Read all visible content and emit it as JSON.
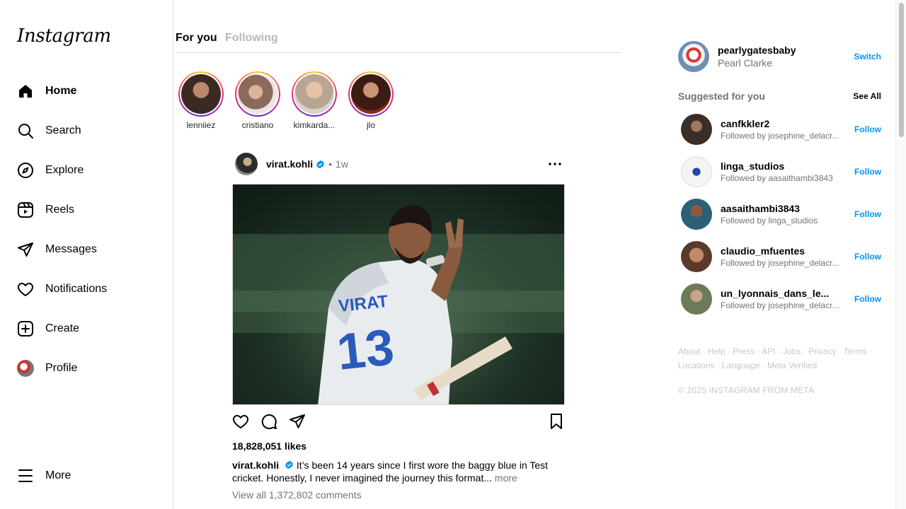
{
  "app": {
    "logo": "Instagram"
  },
  "sidebar": {
    "items": [
      {
        "label": "Home",
        "icon": "home-icon"
      },
      {
        "label": "Search",
        "icon": "search-icon"
      },
      {
        "label": "Explore",
        "icon": "compass-icon"
      },
      {
        "label": "Reels",
        "icon": "reels-icon"
      },
      {
        "label": "Messages",
        "icon": "send-icon"
      },
      {
        "label": "Notifications",
        "icon": "heart-icon"
      },
      {
        "label": "Create",
        "icon": "plus-square-icon"
      },
      {
        "label": "Profile",
        "icon": "avatar"
      }
    ],
    "more_label": "More"
  },
  "feed": {
    "tabs": [
      {
        "label": "For you"
      },
      {
        "label": "Following"
      }
    ],
    "stories": [
      {
        "name": "lenniiez"
      },
      {
        "name": "cristiano"
      },
      {
        "name": "kimkarda..."
      },
      {
        "name": "jlo"
      }
    ]
  },
  "post": {
    "username": "virat.kohli",
    "separator": "•",
    "time": "1w",
    "likes": "18,828,051 likes",
    "caption_user": "virat.kohli",
    "caption_text": "It’s been 14 years since I first wore the baggy blue in Test cricket. Honestly, I never imagined the journey this format...",
    "caption_more": "more",
    "view_comments": "View all 1,372,802 comments"
  },
  "right": {
    "me": {
      "username": "pearlygatesbaby",
      "name": "Pearl Clarke",
      "action": "Switch"
    },
    "suggested_title": "Suggested for you",
    "see_all": "See All",
    "suggestions": [
      {
        "username": "canfkkler2",
        "sub": "Followed by josephine_delacr...",
        "action": "Follow"
      },
      {
        "username": "linga_studios",
        "sub": "Followed by aasaithambi3843",
        "action": "Follow"
      },
      {
        "username": "aasaithambi3843",
        "sub": "Followed by linga_studios",
        "action": "Follow"
      },
      {
        "username": "claudio_mfuentes",
        "sub": "Followed by josephine_delacr...",
        "action": "Follow"
      },
      {
        "username": "un_lyonnais_dans_le...",
        "sub": "Followed by josephine_delacr...",
        "action": "Follow"
      }
    ],
    "footer_links": [
      "About",
      "Help",
      "Press",
      "API",
      "Jobs",
      "Privacy",
      "Terms",
      "Locations",
      "Language",
      "Meta Verified"
    ],
    "copyright": "© 2025 INSTAGRAM FROM META"
  },
  "colors": {
    "accent": "#0095f6",
    "verified": "#0095f6",
    "muted": "#737373",
    "border": "#dbdbdb"
  }
}
